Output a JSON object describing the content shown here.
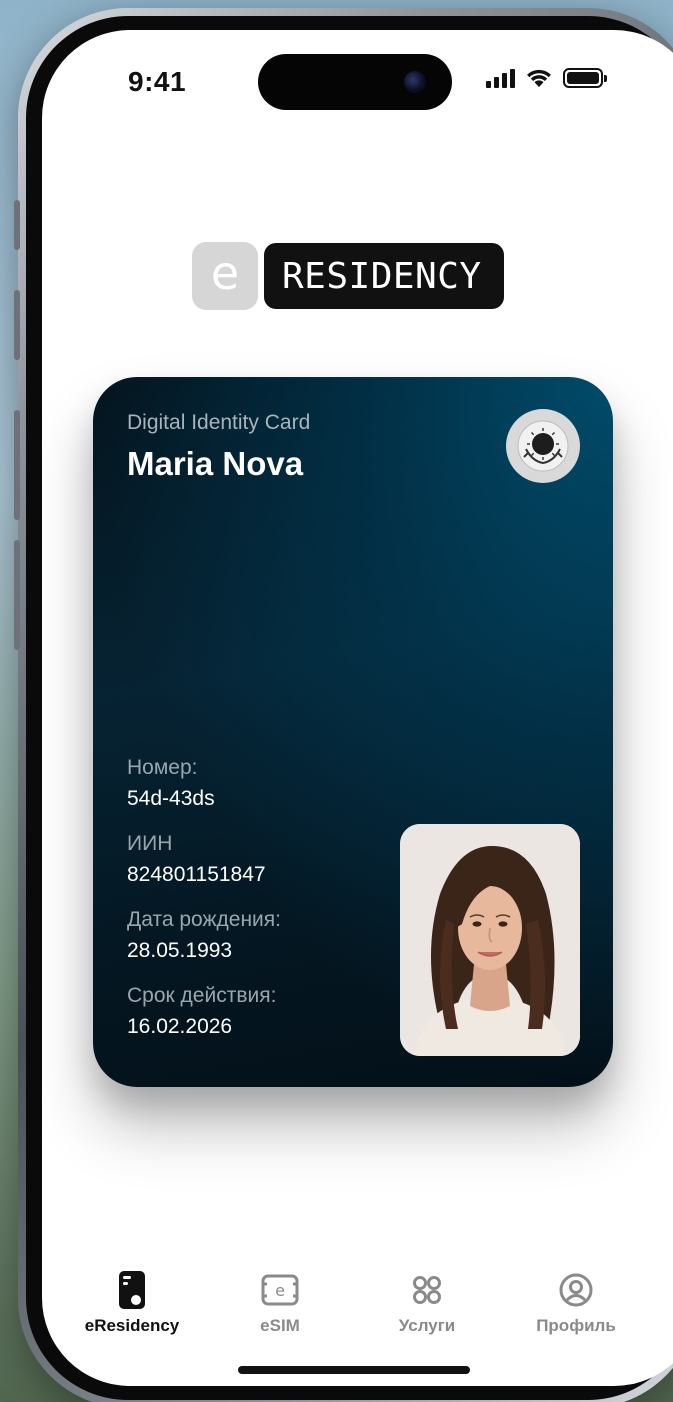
{
  "status_bar": {
    "time": "9:41"
  },
  "logo": {
    "letter": "e",
    "word": "RESIDENCY"
  },
  "card": {
    "subtitle": "Digital Identity Card",
    "name": "Maria Nova",
    "fields": [
      {
        "label": "Номер:",
        "value": "54d-43ds"
      },
      {
        "label": "ИИН",
        "value": "824801151847"
      },
      {
        "label": "Дата рождения:",
        "value": "28.05.1993"
      },
      {
        "label": "Срок действия:",
        "value": "16.02.2026"
      }
    ]
  },
  "tabs": [
    {
      "label": "eResidency",
      "icon": "id-card-icon",
      "active": true
    },
    {
      "label": "eSIM",
      "icon": "esim-icon",
      "active": false
    },
    {
      "label": "Услуги",
      "icon": "services-grid-icon",
      "active": false
    },
    {
      "label": "Профиль",
      "icon": "profile-icon",
      "active": false
    }
  ],
  "colors": {
    "card_dark": "#04141e",
    "card_accent": "#004e6e",
    "tab_active": "#111111",
    "tab_inactive": "#8a8a8a"
  }
}
